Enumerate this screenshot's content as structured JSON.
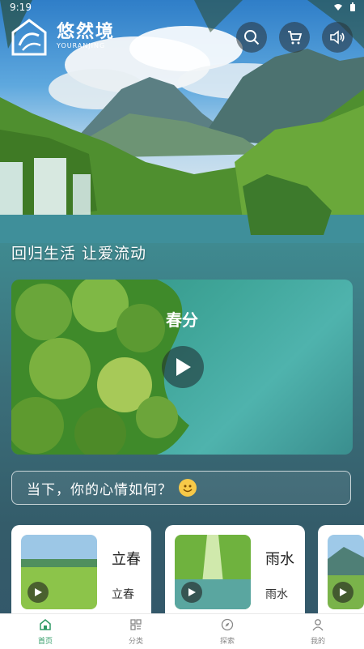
{
  "status_bar": {
    "time": "9:19"
  },
  "brand": {
    "name": "悠然境",
    "subtitle": "YOURANJING"
  },
  "header_actions": [
    {
      "icon": "search-icon"
    },
    {
      "icon": "cart-icon"
    },
    {
      "icon": "speaker-icon"
    }
  ],
  "slogan": "回归生活  让爱流动",
  "hero": {
    "title": "春分"
  },
  "mood": {
    "prompt": "当下，你的心情如何？"
  },
  "cards": [
    {
      "title": "立春",
      "subtitle": "立春"
    },
    {
      "title": "雨水",
      "subtitle": "雨水"
    }
  ],
  "nav": [
    {
      "label": "首页",
      "icon": "home-icon",
      "active": true
    },
    {
      "label": "分类",
      "icon": "category-icon",
      "active": false
    },
    {
      "label": "探索",
      "icon": "compass-icon",
      "active": false
    },
    {
      "label": "我的",
      "icon": "profile-icon",
      "active": false
    }
  ],
  "colors": {
    "accent": "#2f9a66"
  }
}
